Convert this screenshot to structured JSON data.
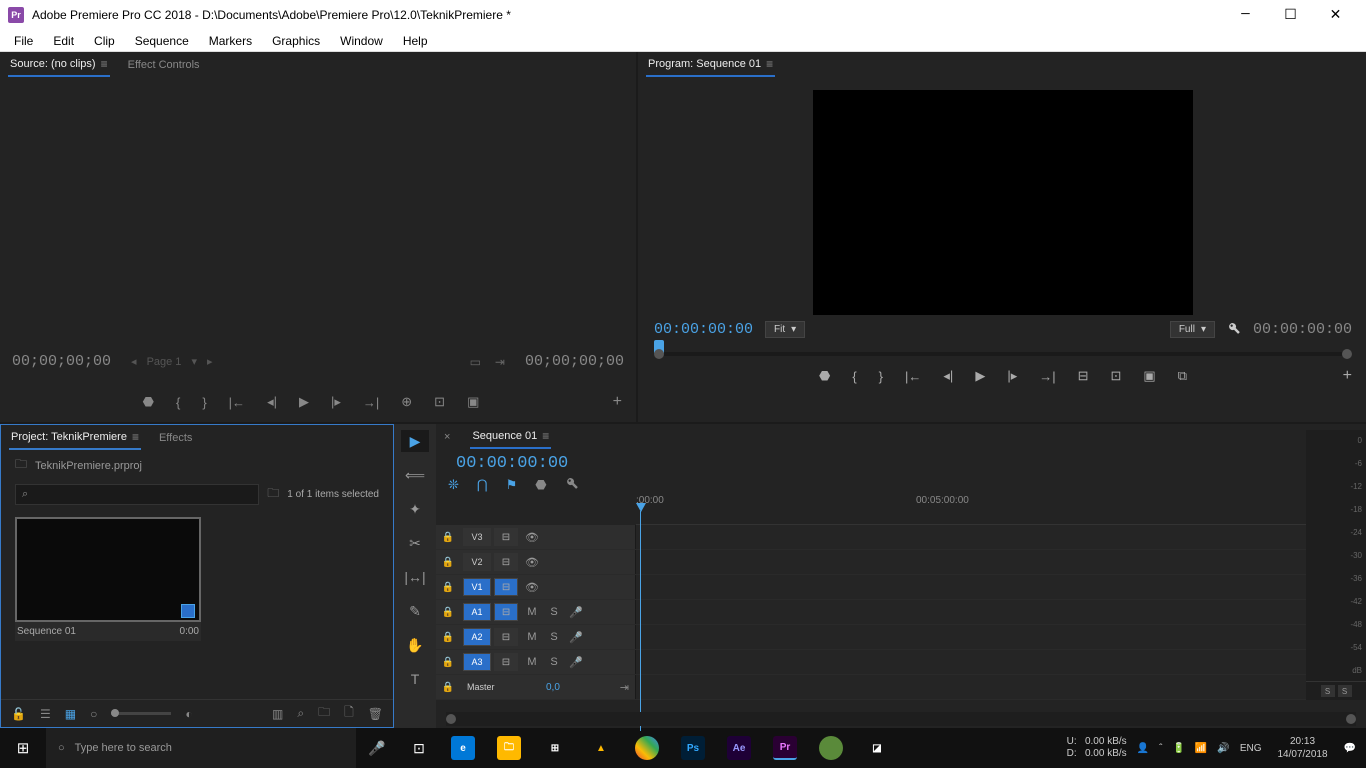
{
  "titlebar": {
    "title": "Adobe Premiere Pro CC 2018 - D:\\Documents\\Adobe\\Premiere Pro\\12.0\\TeknikPremiere *"
  },
  "menu": [
    "File",
    "Edit",
    "Clip",
    "Sequence",
    "Markers",
    "Graphics",
    "Window",
    "Help"
  ],
  "source": {
    "tab": "Source: (no clips)",
    "effects_tab": "Effect Controls",
    "tc_left": "00;00;00;00",
    "tc_right": "00;00;00;00",
    "pager": "Page 1"
  },
  "program": {
    "tab": "Program: Sequence 01",
    "tc_left": "00:00:00:00",
    "tc_right": "00:00:00:00",
    "fit": "Fit",
    "res": "Full"
  },
  "project": {
    "tab": "Project: TeknikPremiere",
    "effects_tab": "Effects",
    "filename": "TeknikPremiere.prproj",
    "status": "1 of 1 items selected",
    "clip": {
      "name": "Sequence 01",
      "dur": "0:00"
    }
  },
  "timeline": {
    "tab": "Sequence 01",
    "tc": "00:00:00:00",
    "r1": ":00:00",
    "r2": "00:05:00:00",
    "r3": "0",
    "tracks_v": [
      "V3",
      "V2",
      "V1"
    ],
    "tracks_a": [
      "A1",
      "A2",
      "A3"
    ],
    "master": "Master",
    "master_val": "0,0"
  },
  "meters": {
    "labels": [
      "0",
      "-6",
      "-12",
      "-18",
      "-24",
      "-30",
      "-36",
      "-42",
      "-48",
      "-54",
      "dB"
    ],
    "solo": "S"
  },
  "taskbar": {
    "search_ph": "Type here to search",
    "net_u": "U:",
    "net_d": "D:",
    "net_u_v": "0.00 kB/s",
    "net_d_v": "0.00 kB/s",
    "lang": "ENG",
    "time": "20:13",
    "date": "14/07/2018"
  }
}
